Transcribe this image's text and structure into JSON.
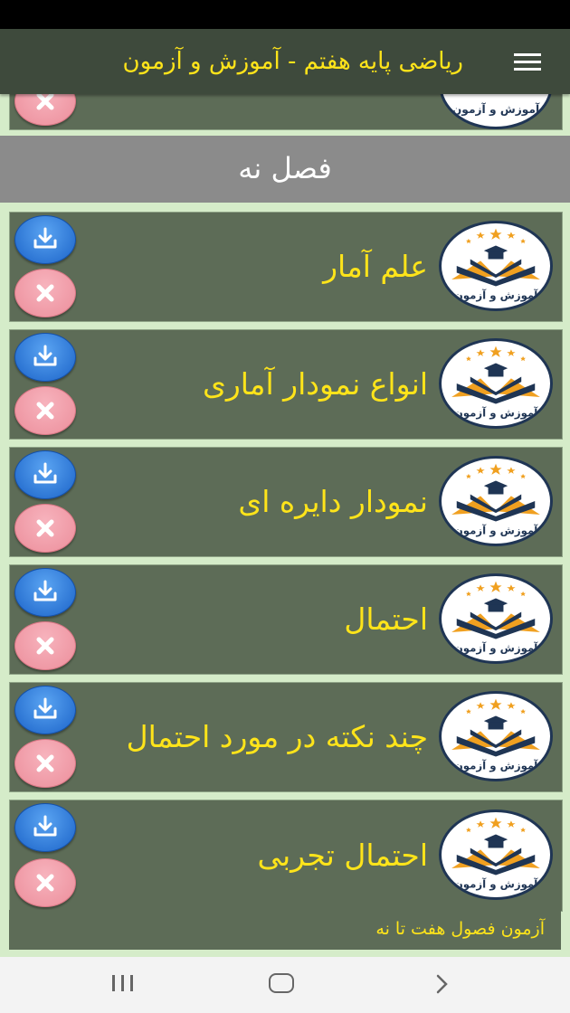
{
  "app_bar": {
    "title": "ریاضی پایه هفتم - آموزش و آزمون",
    "menu_icon": "hamburger-menu-icon"
  },
  "section": {
    "title": "فصل نه"
  },
  "lessons": [
    {
      "title": "علم آمار"
    },
    {
      "title": "انواع نمودار آماری"
    },
    {
      "title": "نمودار دایره ای"
    },
    {
      "title": "احتمال"
    },
    {
      "title": "چند نکته در مورد احتمال"
    },
    {
      "title": "احتمال تجربی"
    }
  ],
  "logo_text": "آموزش و آزمون",
  "footer_link": {
    "label": "آزمون فصول هفت تا نه"
  },
  "colors": {
    "app_bar_bg": "#3e4a3c",
    "title_yellow": "#ffe41a",
    "card_bg": "#5d6c57",
    "page_bg": "#d5ecc9",
    "section_bg": "#8b8b8b",
    "download_blue": "#2f7fe0",
    "remove_pink": "#f2a0ac"
  },
  "icons": {
    "download": "download-icon",
    "remove": "close-icon"
  },
  "nav": {
    "recent": "recent-apps-icon",
    "home": "home-icon",
    "back": "back-icon"
  }
}
